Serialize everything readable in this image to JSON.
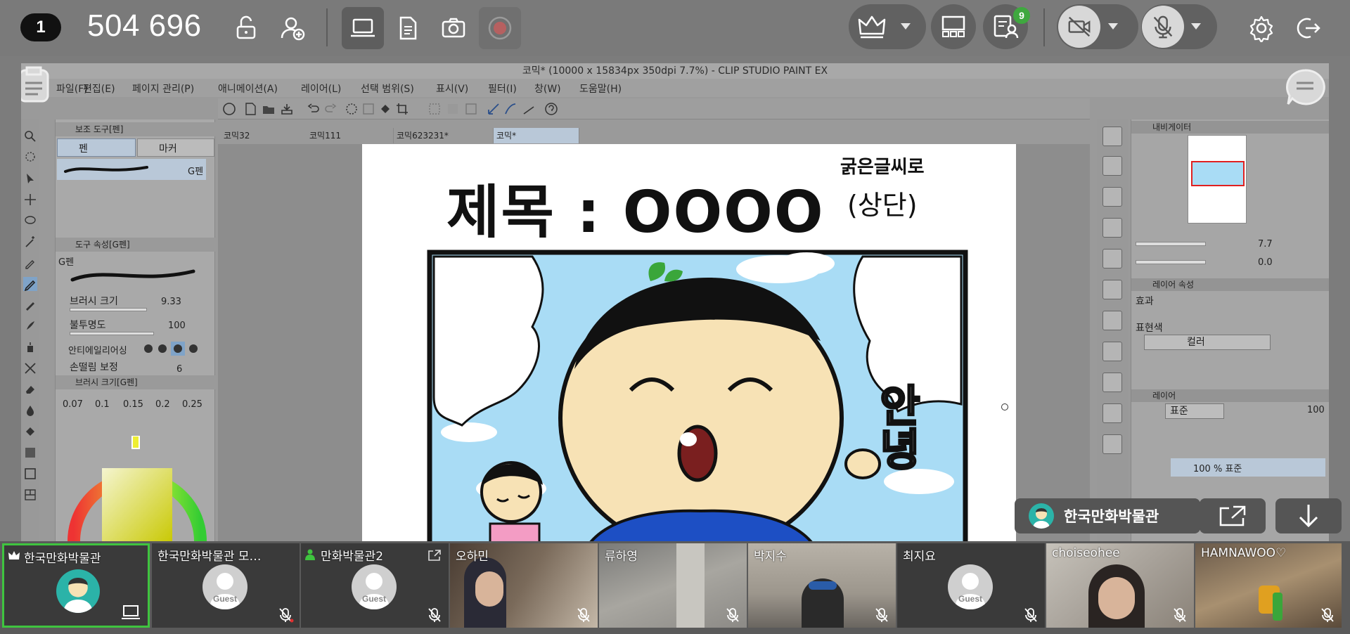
{
  "topbar": {
    "meeting_number": "1",
    "meeting_id": "504 696",
    "chat_badge": "9",
    "icons": [
      "unlock-icon",
      "add-user-icon",
      "screen-share-icon",
      "document-icon",
      "camera-icon",
      "record-icon",
      "crown-icon",
      "layout-icon",
      "participants-icon",
      "video-off-icon",
      "mic-off-icon",
      "settings-icon",
      "exit-icon"
    ]
  },
  "clipstudio": {
    "window_title": "코믹* (10000 x 15834px 350dpi 7.7%)  - CLIP STUDIO PAINT EX",
    "menu": [
      "파일(F)",
      "편집(E)",
      "페이지 관리(P)",
      "애니메이션(A)",
      "레이어(L)",
      "선택 범위(S)",
      "표시(V)",
      "필터(I)",
      "창(W)",
      "도움말(H)"
    ],
    "sub_tool_header": "보조 도구[펜]",
    "sub_tool_tabs": [
      "펜",
      "마커"
    ],
    "brush_name": "G펜",
    "tool_property_header": "도구 속성[G펜]",
    "tool_property_name": "G펜",
    "brush_size_label": "브러시 크기",
    "brush_size_value": "9.33",
    "opacity_label": "불투명도",
    "opacity_value": "100",
    "antialias_label": "안티에일리어싱",
    "stabilize_label": "손떨림 보정",
    "stabilize_value": "6",
    "brush_size_panel_header": "브러시 크기[G펜]",
    "brush_sizes": [
      "0.07",
      "0.1",
      "0.15",
      "0.2",
      "0.25"
    ],
    "doc_tabs": [
      "코믹32",
      "코믹111",
      "코믹623231*",
      "코믹*"
    ],
    "navigator_header": "내비게이터",
    "zoom_value": "7.7",
    "rotate_value": "0.0",
    "layer_property_header": "레이어 속성",
    "effect_label": "효과",
    "expression_color_label": "표현색",
    "expression_color_value": "컬러",
    "layer_header": "레이어",
    "blend_mode": "표준",
    "layer_opacity": "100",
    "layer_entry": "100 % 표준",
    "canvas_title": "제목 : OOOO",
    "canvas_title_sub": "(상단)",
    "canvas_note": "굵은글씨로",
    "canvas_greeting": "안녕"
  },
  "presenter": {
    "name": "한국만화박물관"
  },
  "participants": [
    {
      "name": "한국만화박물관",
      "host": true,
      "type": "avatar"
    },
    {
      "name": "한국만화박물관 모…",
      "host": false,
      "type": "guest"
    },
    {
      "name": "만화박물관2",
      "host": false,
      "type": "guest"
    },
    {
      "name": "오하민",
      "host": false,
      "type": "video"
    },
    {
      "name": "류하영",
      "host": false,
      "type": "video"
    },
    {
      "name": "박지수",
      "host": false,
      "type": "video"
    },
    {
      "name": "최지요",
      "host": false,
      "type": "guest"
    },
    {
      "name": "choiseohee",
      "host": false,
      "type": "video"
    },
    {
      "name": "HAMNAWOO♡",
      "host": false,
      "type": "video"
    }
  ],
  "guest_label": "Guest",
  "colors": {
    "accent_green": "#3fc43f",
    "badge_green": "#3fa83f",
    "avatar_teal": "#2bb3a8",
    "sky_blue": "#a9dcf5"
  }
}
